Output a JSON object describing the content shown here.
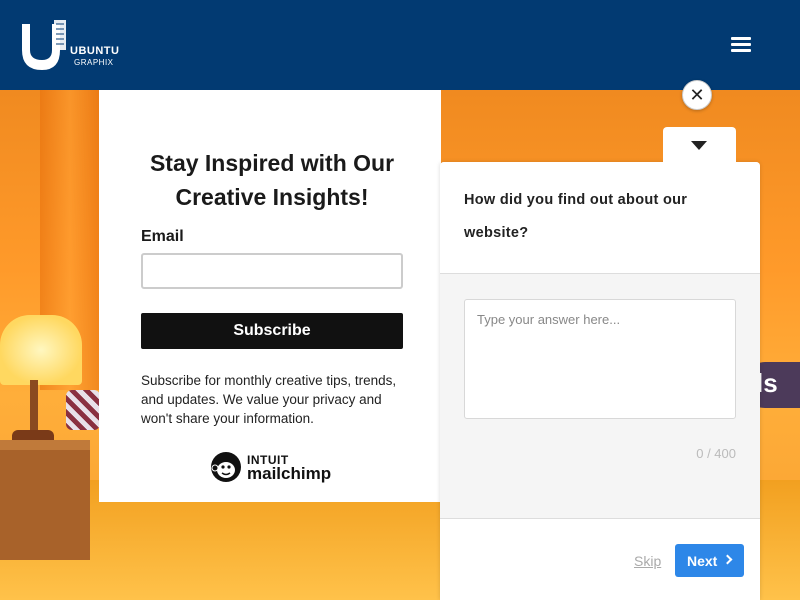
{
  "header": {
    "logo_line1": "UBUNTU",
    "logo_line2": "GRAPHIX",
    "menu_icon": "hamburger-menu-icon",
    "background_color": "#023a72"
  },
  "scene": {
    "pill_label": "ls"
  },
  "newsletter": {
    "title_line1": "Stay Inspired with Our",
    "title_line2": "Creative Insights!",
    "email_label": "Email",
    "email_value": "",
    "subscribe_label": "Subscribe",
    "description": "Subscribe for monthly creative tips, trends, and updates. We value your privacy and won't share your information.",
    "brand_intuit": "INTUIT",
    "brand_name": "mailchimp"
  },
  "close": {
    "label": "✕",
    "icon": "close-icon"
  },
  "survey": {
    "toggle_icon": "caret-down-icon",
    "question": "How did you find out about our website?",
    "answer_value": "",
    "answer_placeholder": "Type your answer here...",
    "char_count": "0 / 400",
    "skip_label": "Skip",
    "next_label": "Next",
    "accent_color": "#2d87e8"
  }
}
